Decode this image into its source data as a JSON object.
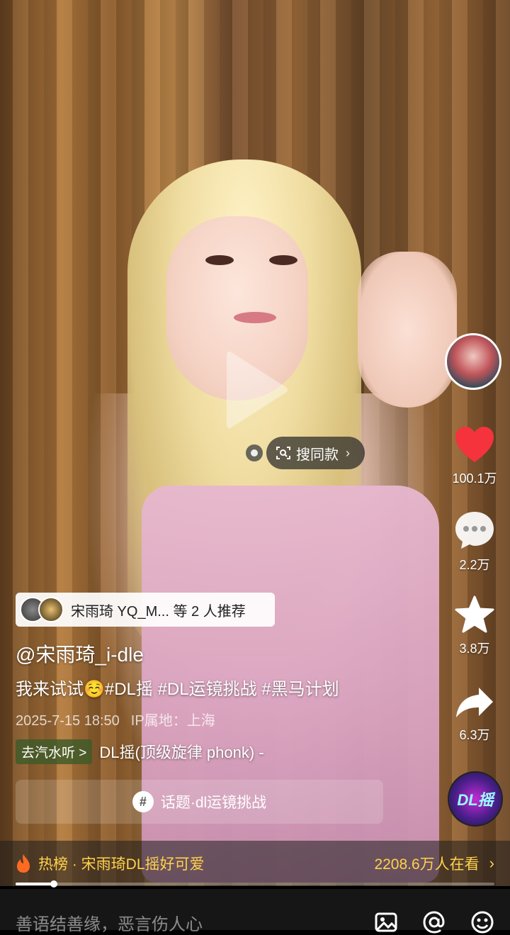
{
  "video": {
    "search_same": "搜同款"
  },
  "side_actions": {
    "likes": "100.1万",
    "comments": "2.2万",
    "favorites": "3.8万",
    "shares": "6.3万",
    "music_disc_text": "DL摇"
  },
  "recommend": {
    "text": "宋雨琦 YQ_M... 等 2 人推荐"
  },
  "author": "@宋雨琦_i-dle",
  "caption": "我来试试☺️#DL摇 #DL运镜挑战 #黑马计划",
  "meta": {
    "time": "2025-7-15 18:50",
    "location": "IP属地：上海"
  },
  "music": {
    "tag": "去汽水听 >",
    "name": "DL摇(顶级旋律 phonk) -"
  },
  "topic": {
    "label": "话题·dl运镜挑战"
  },
  "hot": {
    "text": "热榜 · 宋雨琦DL摇好可爱",
    "viewers": "2208.6万人在看"
  },
  "progress": {
    "fraction": 0.08
  },
  "comment": {
    "placeholder": "善语结善缘，恶言伤人心"
  },
  "colors": {
    "like": "#f4333c",
    "hot": "#ffd24a"
  }
}
